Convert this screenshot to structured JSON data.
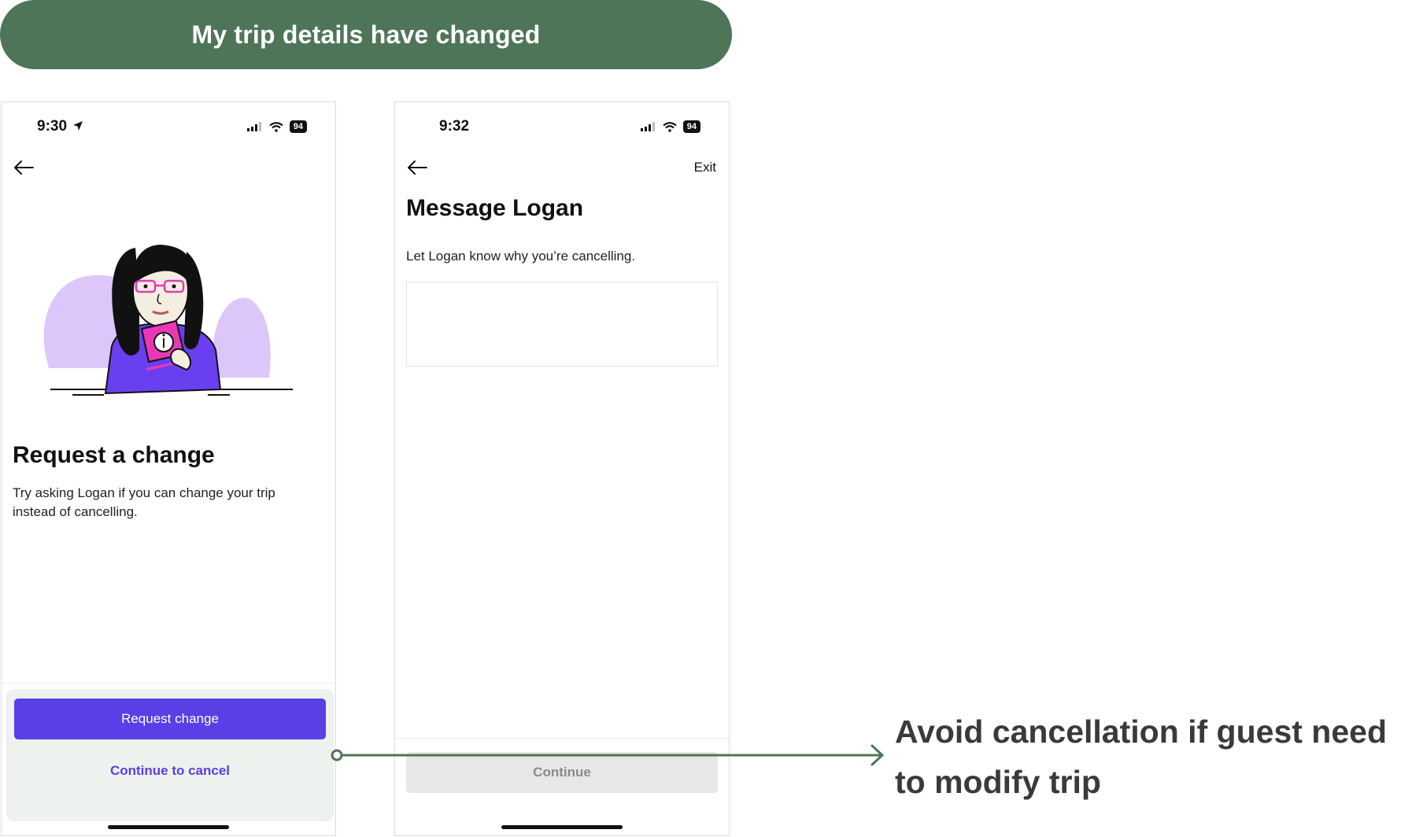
{
  "banner": {
    "title": "My trip details have changed"
  },
  "screen1": {
    "status": {
      "time": "9:30",
      "battery": "94"
    },
    "title": "Request a change",
    "description": "Try asking Logan if you can change your trip instead of cancelling.",
    "primary_button": "Request change",
    "secondary_link": "Continue to cancel"
  },
  "screen2": {
    "status": {
      "time": "9:32",
      "battery": "94"
    },
    "exit_label": "Exit",
    "title": "Message Logan",
    "description": "Let Logan know why you’re cancelling.",
    "message_value": "",
    "continue_button": "Continue"
  },
  "annotation": {
    "text": "Avoid cancellation if guest need to modify trip"
  },
  "colors": {
    "banner": "#4f7558",
    "accent": "#5a3ee6",
    "panel": "#edf2ee",
    "connector": "#4f7558"
  },
  "icons": [
    "back-arrow-icon",
    "location-arrow-icon",
    "signal-icon",
    "wifi-icon",
    "battery-icon",
    "info-icon"
  ]
}
